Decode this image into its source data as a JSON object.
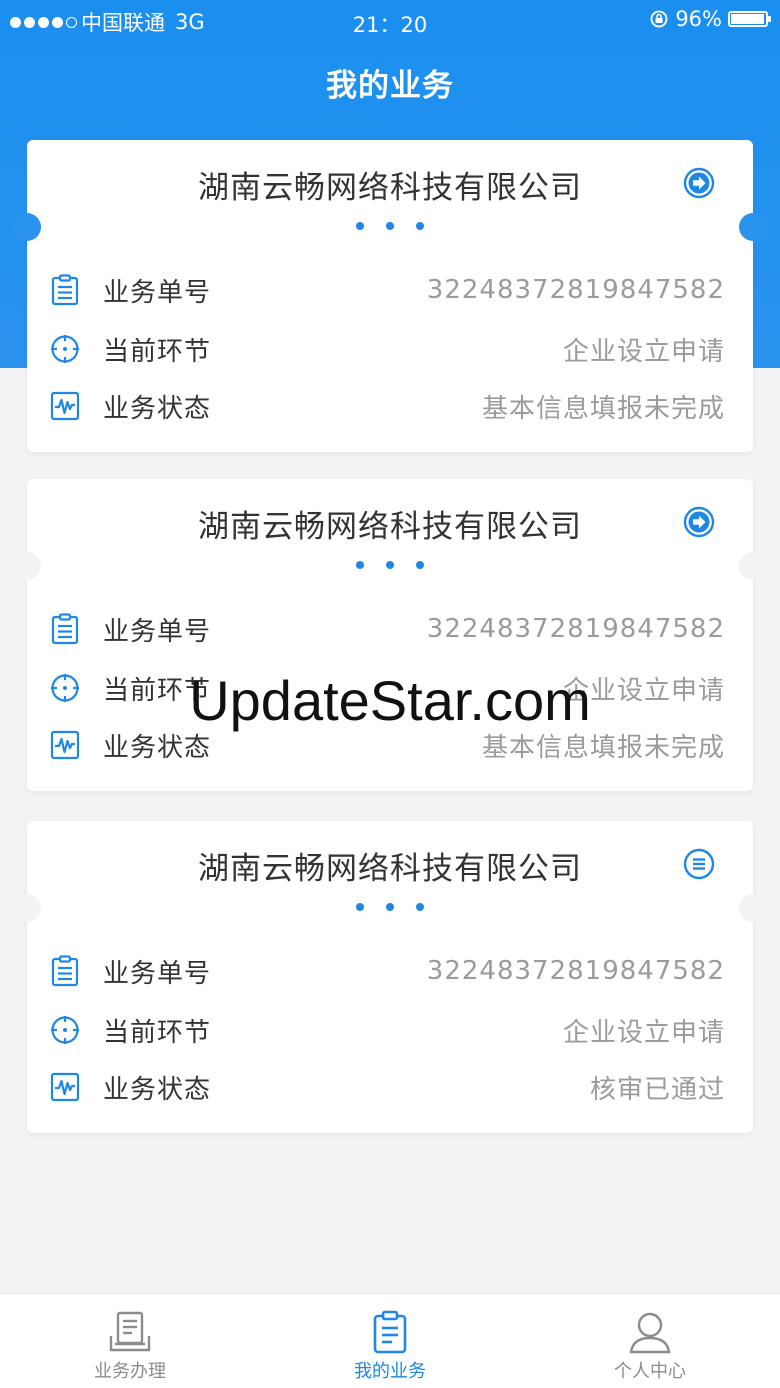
{
  "status_bar": {
    "carrier": "中国联通",
    "network": "3G",
    "time": "21：20",
    "battery": "96%",
    "battery_level": 0.96
  },
  "header": {
    "title": "我的业务"
  },
  "labels": {
    "business_no": "业务单号",
    "current_step": "当前环节",
    "business_status": "业务状态"
  },
  "cards": [
    {
      "company": "湖南云畅网络科技有限公司",
      "action_icon": "arrow-right-circle-icon",
      "business_no": "32248372819847582",
      "current_step": "企业设立申请",
      "status": "基本信息填报未完成"
    },
    {
      "company": "湖南云畅网络科技有限公司",
      "action_icon": "arrow-right-circle-icon",
      "business_no": "32248372819847582",
      "current_step": "企业设立申请",
      "status": "基本信息填报未完成"
    },
    {
      "company": "湖南云畅网络科技有限公司",
      "action_icon": "list-circle-icon",
      "business_no": "32248372819847582",
      "current_step": "企业设立申请",
      "status": "核审已通过"
    }
  ],
  "watermark": "UpdateStar.com",
  "tabs": [
    {
      "label": "业务办理",
      "icon": "business-handle-icon",
      "active": false
    },
    {
      "label": "我的业务",
      "icon": "clipboard-icon",
      "active": true
    },
    {
      "label": "个人中心",
      "icon": "user-icon",
      "active": false
    }
  ],
  "colors": {
    "primary": "#1f87e4",
    "header": "#1a8ff0",
    "background": "#f2f3f5",
    "value_text": "#9b9b9b"
  }
}
